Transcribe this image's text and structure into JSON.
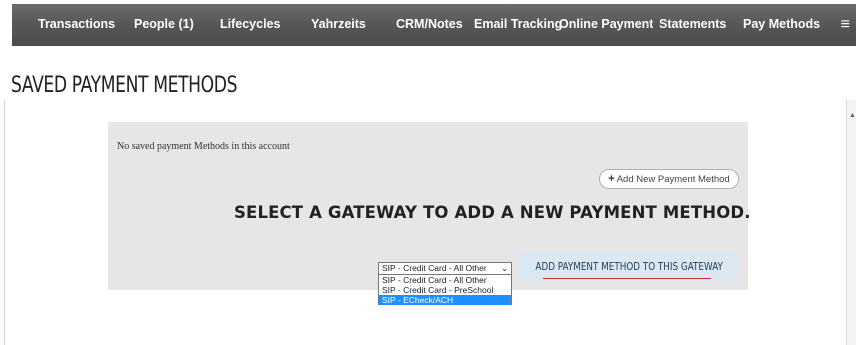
{
  "nav": {
    "items": [
      {
        "label": "Transactions"
      },
      {
        "label": "People (1)"
      },
      {
        "label": "Lifecycles"
      },
      {
        "label": "Yahrzeits"
      },
      {
        "label": "CRM/Notes"
      },
      {
        "label": "Email Tracking"
      },
      {
        "label": "Online Payment"
      },
      {
        "label": "Statements"
      },
      {
        "label": "Pay Methods"
      }
    ],
    "menu_icon": "≡"
  },
  "page": {
    "title": "SAVED PAYMENT METHODS"
  },
  "panel": {
    "no_saved_text": "No saved payment Methods in this account",
    "add_button_label": "Add New Payment Method",
    "add_button_icon": "+",
    "heading": "SELECT A GATEWAY TO ADD A NEW PAYMENT METHOD.",
    "gateway_select": {
      "selected": "SIP - Credit Card - All Other",
      "options": [
        "SIP - Credit Card - All Other",
        "SIP - Credit Card - PreSchool",
        "SIP - ECheck/ACH"
      ],
      "highlighted_index": 2
    },
    "gateway_button_label": "ADD PAYMENT METHOD TO THIS GATEWAY"
  },
  "colors": {
    "nav_bg": "#555555",
    "panel_bg": "#e6e6e6",
    "gateway_button_bg": "#dbe8f1",
    "highlight": "#1e90ff",
    "underline": "#d12e2e"
  }
}
